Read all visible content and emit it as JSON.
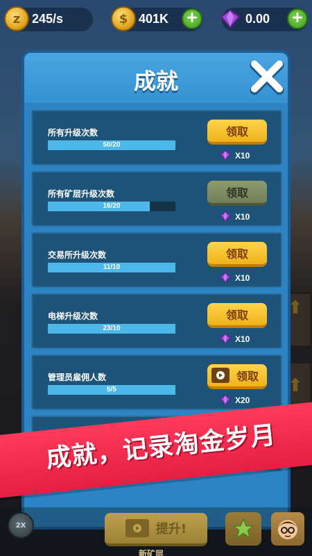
{
  "hud": {
    "idle_rate": "245/s",
    "coins": "401K",
    "gems": "0.00",
    "plus_label": "+"
  },
  "modal": {
    "title": "成就",
    "rows": [
      {
        "label": "所有升级次数",
        "progress_text": "50/20",
        "progress": 1.0,
        "button": "领取",
        "state": "active",
        "reward": "X10"
      },
      {
        "label": "所有矿层升级次数",
        "progress_text": "16/20",
        "progress": 0.8,
        "button": "领取",
        "state": "disabled",
        "reward": "X10"
      },
      {
        "label": "交易所升级次数",
        "progress_text": "11/10",
        "progress": 1.0,
        "button": "领取",
        "state": "active",
        "reward": "X10"
      },
      {
        "label": "电梯升级次数",
        "progress_text": "23/10",
        "progress": 1.0,
        "button": "领取",
        "state": "active",
        "reward": "X10"
      },
      {
        "label": "管理员雇佣人数",
        "progress_text": "5/5",
        "progress": 1.0,
        "button": "领取",
        "state": "video",
        "reward": "X20"
      }
    ]
  },
  "banner": {
    "text": "成就，记录淘金岁月"
  },
  "bottom": {
    "boost_label": "2X",
    "upgrade_label": "提升!",
    "sub_label": "新矿层"
  },
  "colors": {
    "modal_bg": "#2d84c4",
    "row_bg": "#1d5378",
    "progress_fill": "#4fb8ea",
    "claim_active": "#ffd44a",
    "claim_disabled": "#8e9b6e",
    "banner": "#e51e43",
    "gem": "#a24bd8"
  }
}
